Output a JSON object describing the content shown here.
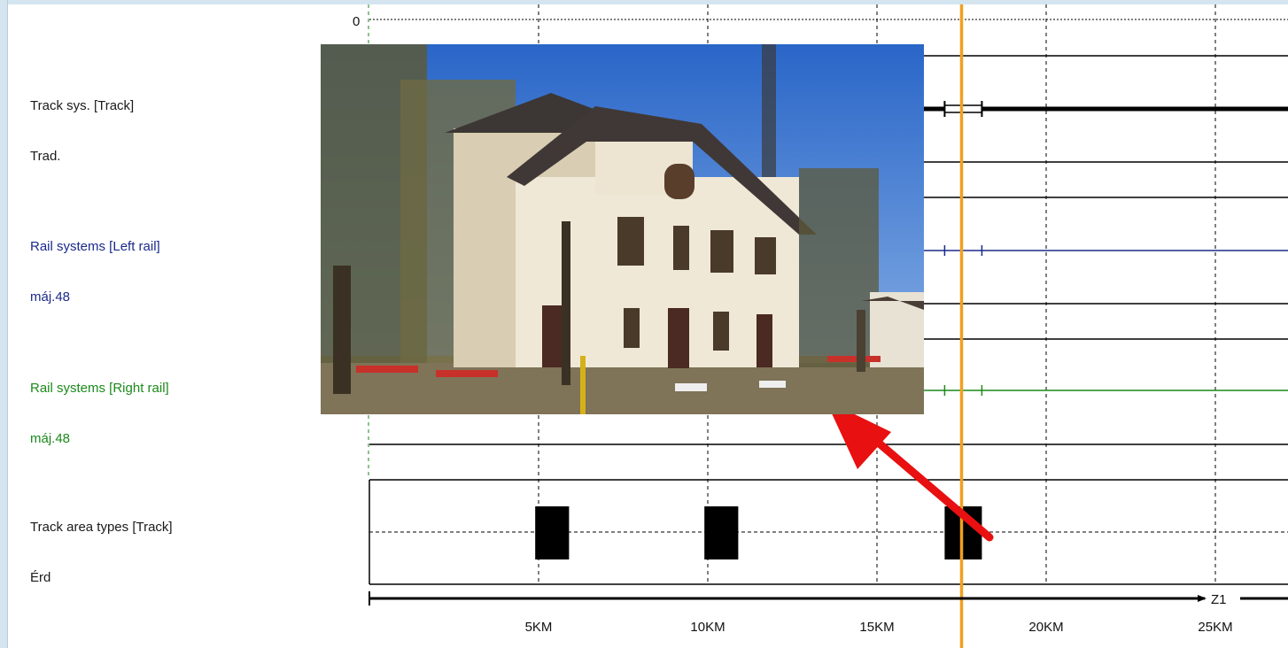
{
  "rows": [
    {
      "title": "Track sys. [Track]",
      "value": "Trad.",
      "color": "#1a1a1a"
    },
    {
      "title": "Rail systems [Left rail]",
      "value": "máj.48",
      "color": "#1a2a8a"
    },
    {
      "title": "Rail systems [Right rail]",
      "value": "máj.48",
      "color": "#1a8a1a"
    },
    {
      "title": "Track area types [Track]",
      "value": "Érd",
      "color": "#1a1a1a"
    }
  ],
  "axis": {
    "zero_label": "0",
    "tick_labels": [
      "5KM",
      "10KM",
      "15KM",
      "20KM",
      "25KM"
    ],
    "zone_label": "Z1"
  },
  "chart_data": {
    "type": "track diagram",
    "x_unit": "KM",
    "xlim": [
      0,
      25
    ],
    "cursor_km": 17.5,
    "track_area_blocks_km": [
      [
        4.9,
        5.9
      ],
      [
        9.9,
        10.9
      ],
      [
        17.0,
        18.1
      ]
    ],
    "track_system_segment_km": [
      17.0,
      18.1
    ],
    "rail_marker_km": [
      17.0,
      18.1
    ]
  },
  "colors": {
    "cursor": "#f0a020",
    "left_rail": "#1a2a8a",
    "right_rail": "#1a8a1a",
    "arrow": "#e81010",
    "frame": "#d4e5ef"
  },
  "photo": {
    "description_icon": "station-building-photo"
  }
}
